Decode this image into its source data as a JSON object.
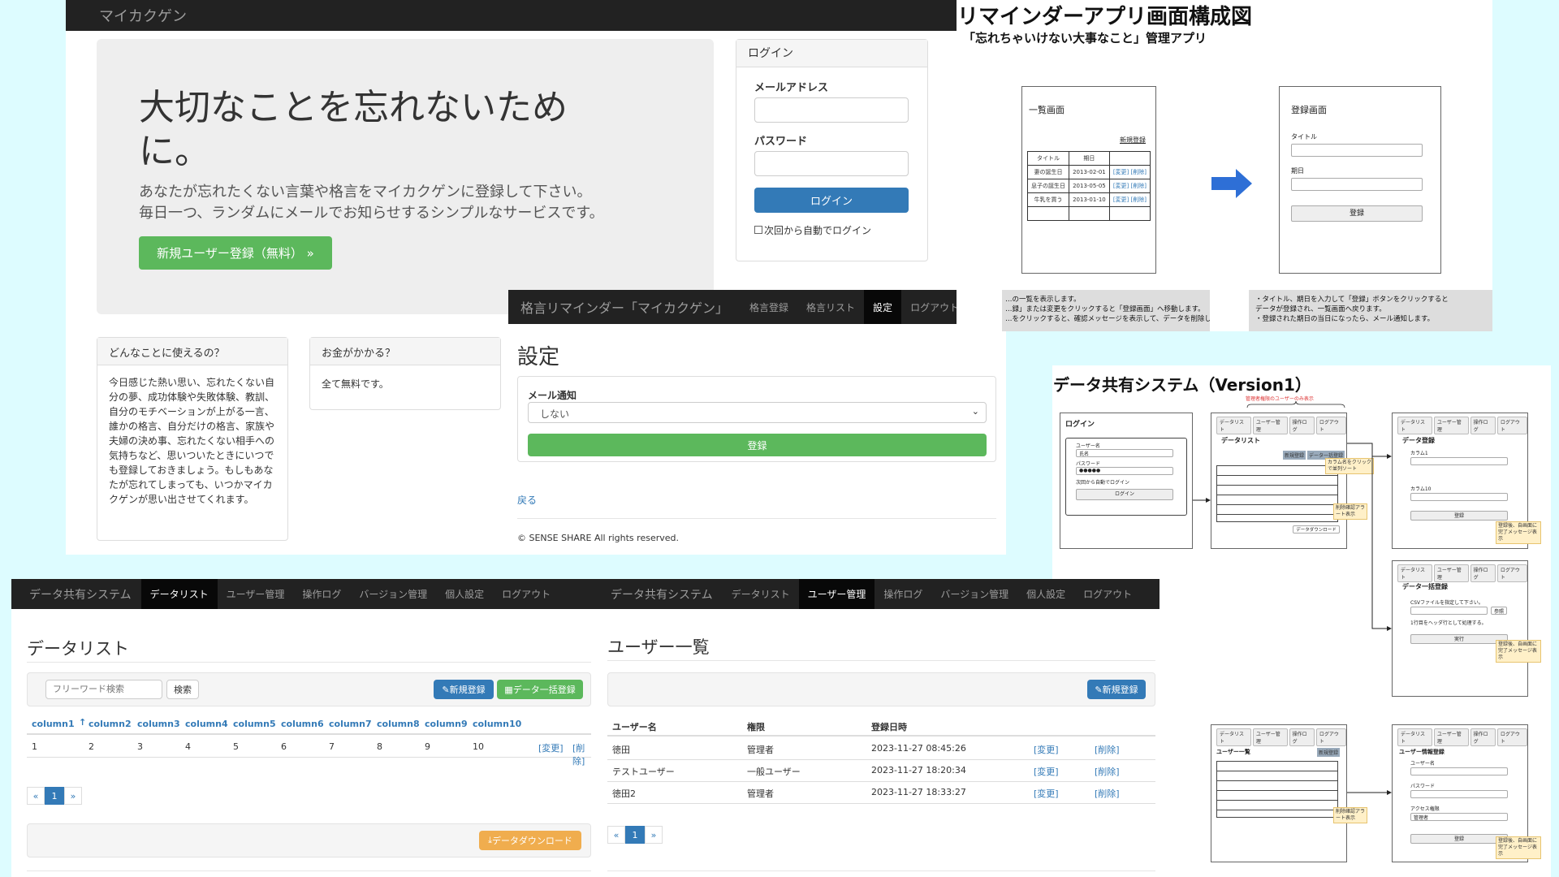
{
  "app1": {
    "brand": "マイカクゲン",
    "hero_title": "大切なことを忘れないために。",
    "hero_desc1": "あなたが忘れたくない言葉や格言をマイカクゲンに登録して下さい。",
    "hero_desc2": "毎日一つ、ランダムにメールでお知らせするシンプルなサービスです。",
    "register_button": "新規ユーザー登録（無料） »",
    "login": {
      "title": "ログイン",
      "email_label": "メールアドレス",
      "password_label": "パスワード",
      "button": "ログイン",
      "remember": "次回から自動でログイン"
    },
    "card1_title": "どんなことに使えるの？",
    "card1_body": "今日感じた熱い思い、忘れたくない自分の夢、成功体験や失敗体験、教訓、自分のモチベーションが上がる一言、誰かの格言、自分だけの格言、家族や夫婦の決め事、忘れたくない相手への気持ちなど、思いついたときにいつでも登録しておきましょう。もしもあなたが忘れてしまっても、いつかマイカクゲンが思い出させてくれます。",
    "card2_title": "お金がかかる？",
    "card2_body": "全て無料です。"
  },
  "settings": {
    "brand": "格言リマインダー「マイカクゲン」",
    "nav": [
      "格言登録",
      "格言リスト",
      "設定",
      "ログアウト"
    ],
    "title": "設定",
    "mail_label": "メール通知",
    "mail_value": "しない",
    "submit": "登録",
    "back": "戻る",
    "footer": "© SENSE SHARE All rights reserved."
  },
  "diagram1": {
    "title": "リマインダーアプリ画面構成図",
    "subtitle": "「忘れちゃいけない大事なこと」管理アプリ",
    "list_title": "一覧画面",
    "new_link": "新規登録",
    "table_head": [
      "タイトル",
      "期日"
    ],
    "rows": [
      [
        "妻の誕生日",
        "2013-02-01"
      ],
      [
        "息子の誕生日",
        "2013-05-05"
      ],
      [
        "牛乳を買う",
        "2013-01-10"
      ]
    ],
    "row_actions": "[変更] [削除]",
    "reg_title": "登録画面",
    "reg_label1": "タイトル",
    "reg_label2": "期日",
    "reg_button": "登録",
    "note_left1": "…の一覧を表示します。",
    "note_left2": "…録」または変更をクリックすると「登録画面」へ移動します。",
    "note_left3": "…をクリックすると、確認メッセージを表示して、データを削除します。",
    "note_right1": "・タイトル、期日を入力して「登録」ボタンをクリックすると",
    "note_right2": "データが登録され、一覧画面へ戻ります。",
    "note_right3": "・登録された期日の当日になったら、メール通知します。"
  },
  "diagram2": {
    "title": "データ共有システム（Version1）",
    "admin_note": "管理者権限のユーザーのみ表示",
    "login_title": "ログイン",
    "login_user": "ユーザー名",
    "login_user_val": "氏名",
    "login_pass": "パスワード",
    "login_pass_val": "●●●●●",
    "login_remember": "次回から自動でログイン",
    "login_btn": "ログイン",
    "tabs": [
      "データリスト",
      "ユーザー管理",
      "操作ログ",
      "ログアウト"
    ],
    "list_title": "データリスト",
    "list_btn1": "新規登録",
    "list_btn2": "データ一括登録",
    "sort_note": "カラム名をクリックで並列ソート",
    "confirm_note": "削除確認アラート表示",
    "download_btn": "データダウンロード",
    "reg_title": "データ登録",
    "reg_col1": "カラム1",
    "reg_col10": "カラム10",
    "reg_btn": "登録",
    "done_note": "登録後、自画面に完了メッセージ表示",
    "bulk_title": "データ一括登録",
    "bulk_desc": "CSVファイルを指定して下さい。",
    "bulk_ref": "参照",
    "bulk_check": "1行目をヘッダ行として処理する。",
    "bulk_btn": "実行",
    "users_title": "ユーザー一覧",
    "users_new": "新規登録",
    "users_head": [
      "ユーザー名",
      "権限",
      "登録日時"
    ],
    "user_info_title": "ユーザー情報登録",
    "ui_user": "ユーザー名",
    "ui_pass": "パスワード",
    "ui_role": "アクセス権限",
    "ui_role_val": "管理者",
    "ui_btn": "登録"
  },
  "datalist": {
    "brand": "データ共有システム",
    "nav": [
      "データリスト",
      "ユーザー管理",
      "操作ログ",
      "バージョン管理",
      "個人設定",
      "ログアウト"
    ],
    "title": "データリスト",
    "search_placeholder": "フリーワード検索",
    "search_button": "検索",
    "new_button": "新規登録",
    "bulk_button": "データ一括登録",
    "columns": [
      "column1",
      "column2",
      "column3",
      "column4",
      "column5",
      "column6",
      "column7",
      "column8",
      "column9",
      "column10"
    ],
    "row": [
      "1",
      "2",
      "3",
      "4",
      "5",
      "6",
      "7",
      "8",
      "9",
      "10"
    ],
    "edit": "[変更]",
    "delete": "[削除]",
    "pager": [
      "«",
      "1",
      "»"
    ],
    "download": "データダウンロード"
  },
  "users": {
    "brand": "データ共有システム",
    "nav": [
      "データリスト",
      "ユーザー管理",
      "操作ログ",
      "バージョン管理",
      "個人設定",
      "ログアウト"
    ],
    "title": "ユーザー一覧",
    "new_button": "新規登録",
    "headers": [
      "ユーザー名",
      "権限",
      "登録日時"
    ],
    "rows": [
      {
        "name": "徳田",
        "role": "管理者",
        "date": "2023-11-27 08:45:26"
      },
      {
        "name": "テストユーザー",
        "role": "一般ユーザー",
        "date": "2023-11-27 18:20:34"
      },
      {
        "name": "徳田2",
        "role": "管理者",
        "date": "2023-11-27 18:33:27"
      }
    ],
    "edit": "[変更]",
    "delete": "[削除]",
    "pager": [
      "«",
      "1",
      "»"
    ]
  },
  "colors": {
    "navbar": "#222222",
    "primary": "#337ab7",
    "success": "#5cb85c",
    "warning": "#f0ad4e",
    "arrow": "#2e6fd6"
  }
}
